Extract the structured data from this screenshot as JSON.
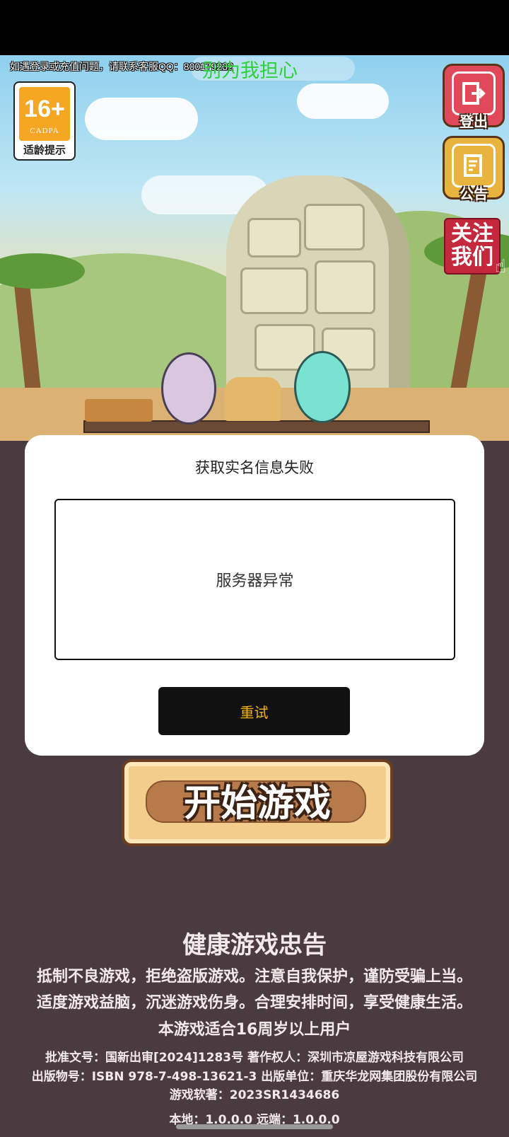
{
  "banner": {
    "customer_service": "如遇登录或充值问题，请联系客服QQ：800179232",
    "marquee": "别为我担心"
  },
  "age_badge": {
    "age": "16+",
    "org": "CADPA",
    "hint": "适龄提示"
  },
  "side_buttons": {
    "logout_label": "登出",
    "notice_label": "公告",
    "follow_label": "关注我们"
  },
  "dialog": {
    "title": "获取实名信息失败",
    "message": "服务器异常",
    "retry_label": "重试"
  },
  "start_button": {
    "label": "开始游戏"
  },
  "footer": {
    "title": "健康游戏忠告",
    "line1": "抵制不良游戏，拒绝盗版游戏。注意自我保护，谨防受骗上当。",
    "line2": "适度游戏益脑，沉迷游戏伤身。合理安排时间，享受健康生活。",
    "line3": "本游戏适合16周岁以上用户",
    "approval": "批准文号：国新出审[2024]1283号  著作权人：深圳市凉屋游戏科技有限公司",
    "publish": "出版物号：ISBN 978-7-498-13621-3  出版单位：重庆华龙网集团股份有限公司",
    "copyright": "游戏软著：2023SR1434686",
    "version": "本地：1.0.0.0  远端：1.0.0.0"
  },
  "colors": {
    "background": "#4a3b40",
    "retry_text": "#f5b400",
    "marquee_text": "#2ecf3b",
    "age_badge": "#f5a623"
  },
  "icons": [
    "logout-icon",
    "notice-icon",
    "hand-pointer-icon"
  ]
}
